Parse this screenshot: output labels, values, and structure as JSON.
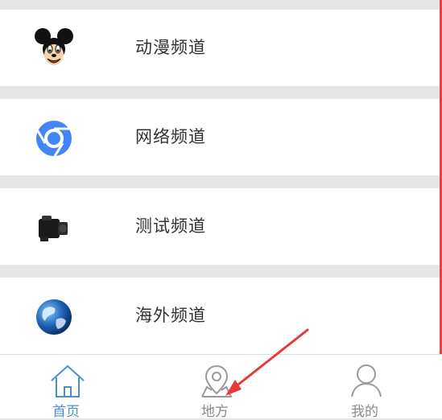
{
  "colors": {
    "background": "#e6e6e6",
    "card": "#ffffff",
    "active_tab": "#4a8fd9",
    "inactive_tab": "#8a8a8a",
    "annotation_arrow": "#e53935"
  },
  "channels": [
    {
      "label": "动漫频道",
      "icon": "mickey-mouse-icon"
    },
    {
      "label": "网络频道",
      "icon": "chrome-browser-icon"
    },
    {
      "label": "测试频道",
      "icon": "camera-icon"
    },
    {
      "label": "海外频道",
      "icon": "globe-icon"
    }
  ],
  "tabbar": {
    "tabs": [
      {
        "label": "首页",
        "icon": "home-icon",
        "active": true
      },
      {
        "label": "地方",
        "icon": "map-pin-icon",
        "active": false
      },
      {
        "label": "我的",
        "icon": "user-icon",
        "active": false
      }
    ]
  }
}
